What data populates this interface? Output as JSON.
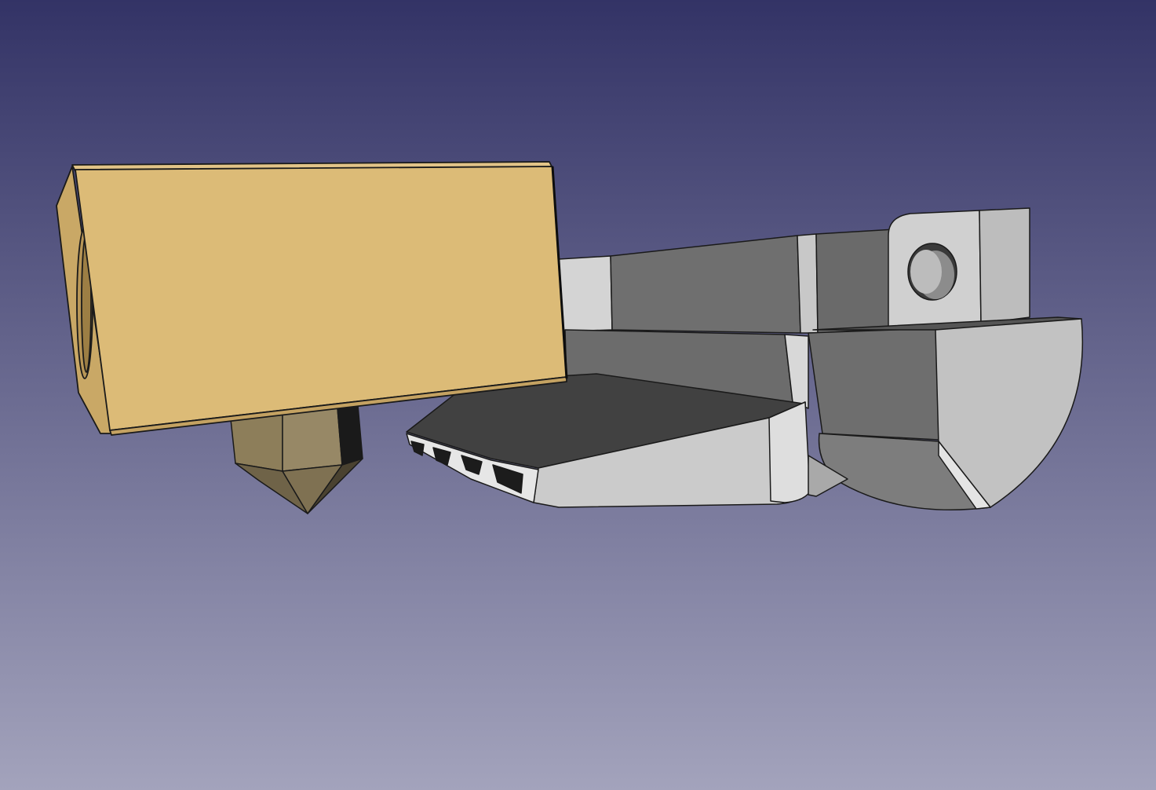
{
  "viewport": {
    "background_top": "#333366",
    "background_bottom": "#a3a3bc"
  },
  "scene": {
    "objects": [
      {
        "name": "heater-block",
        "color": "#dcbb77"
      },
      {
        "name": "nozzle",
        "color": "#8d7e5a"
      },
      {
        "name": "fan-duct",
        "color": "#c6c6c6"
      }
    ]
  }
}
